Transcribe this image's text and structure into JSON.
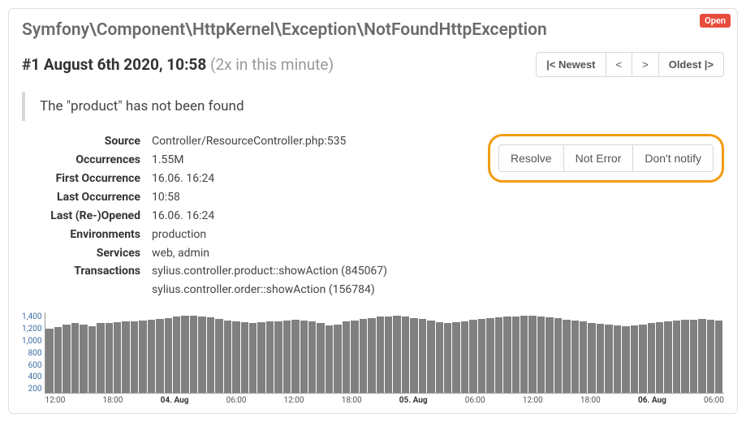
{
  "badge": "Open",
  "title": "Symfony\\Component\\HttpKernel\\Exception\\NotFoundHttpException",
  "subhead": {
    "prefix": "#1",
    "date": "August 6th 2020, 10:58",
    "suffix": "(2x in this minute)"
  },
  "nav": {
    "newest": "|< Newest",
    "prev": "<",
    "next": ">",
    "oldest": "Oldest |>"
  },
  "message": "The \"product\" has not been found",
  "details": {
    "source_label": "Source",
    "source_value": "Controller/ResourceController.php:535",
    "occurrences_label": "Occurrences",
    "occurrences_value": "1.55M",
    "first_label": "First Occurrence",
    "first_value": "16.06. 16:24",
    "last_label": "Last Occurrence",
    "last_value": "10:58",
    "reopened_label": "Last (Re-)Opened",
    "reopened_value": "16.06. 16:24",
    "env_label": "Environments",
    "env_value": "production",
    "services_label": "Services",
    "services_value": "web, admin",
    "trans_label": "Transactions",
    "trans_value1": "sylius.controller.product::showAction (845067)",
    "trans_value2": "sylius.controller.order::showAction (156784)"
  },
  "actions": {
    "resolve": "Resolve",
    "not_error": "Not Error",
    "dont_notify": "Don't notify"
  },
  "chart_data": {
    "type": "bar",
    "ylabel": "",
    "ylim": [
      0,
      1500
    ],
    "y_ticks": [
      "1,400",
      "1,200",
      "1,000",
      "800",
      "600",
      "400",
      "200"
    ],
    "x_ticks": [
      "12:00",
      "18:00",
      "04. Aug",
      "06:00",
      "12:00",
      "18:00",
      "05. Aug",
      "06:00",
      "12:00",
      "18:00",
      "06. Aug",
      "06:00"
    ],
    "x_bold": [
      false,
      false,
      true,
      false,
      false,
      false,
      true,
      false,
      false,
      false,
      true,
      false
    ],
    "values": [
      1200,
      1230,
      1280,
      1300,
      1280,
      1250,
      1300,
      1310,
      1320,
      1340,
      1330,
      1350,
      1360,
      1380,
      1400,
      1430,
      1450,
      1440,
      1430,
      1410,
      1380,
      1350,
      1340,
      1320,
      1300,
      1320,
      1340,
      1330,
      1350,
      1360,
      1350,
      1340,
      1300,
      1260,
      1280,
      1330,
      1350,
      1380,
      1400,
      1420,
      1430,
      1440,
      1420,
      1400,
      1380,
      1350,
      1320,
      1300,
      1320,
      1340,
      1360,
      1380,
      1400,
      1410,
      1420,
      1430,
      1440,
      1450,
      1430,
      1410,
      1390,
      1370,
      1350,
      1330,
      1310,
      1290,
      1270,
      1260,
      1250,
      1260,
      1280,
      1300,
      1320,
      1340,
      1350,
      1360,
      1370,
      1380,
      1370,
      1350
    ]
  }
}
